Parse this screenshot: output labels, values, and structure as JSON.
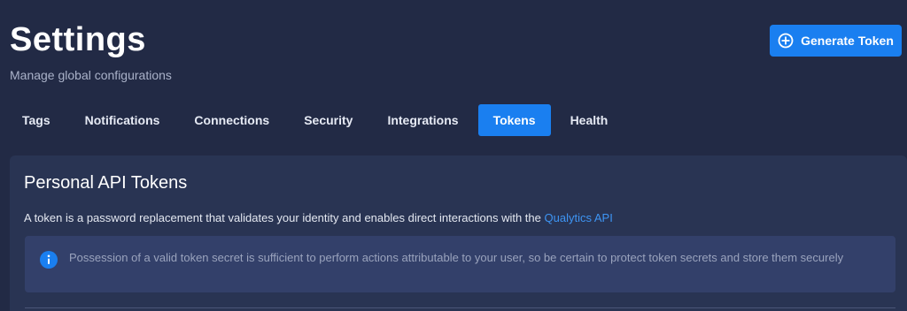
{
  "header": {
    "title": "Settings",
    "subtitle": "Manage global configurations",
    "generate_button_label": "Generate Token"
  },
  "tabs": [
    {
      "label": "Tags",
      "active": false
    },
    {
      "label": "Notifications",
      "active": false
    },
    {
      "label": "Connections",
      "active": false
    },
    {
      "label": "Security",
      "active": false
    },
    {
      "label": "Integrations",
      "active": false
    },
    {
      "label": "Tokens",
      "active": true
    },
    {
      "label": "Health",
      "active": false
    }
  ],
  "tokens_panel": {
    "title": "Personal API Tokens",
    "description": "A token is a password replacement that validates your identity and enables direct interactions with the ",
    "link_text": "Qualytics API",
    "info_message": "Possession of a valid token secret is sufficient to perform actions attributable to your user, so be certain to protect token secrets and store them securely"
  },
  "icons": {
    "generate_button": "plus-circle-icon",
    "info": "info-icon"
  },
  "colors": {
    "background": "#222a45",
    "panel": "#293453",
    "accent": "#1a7ff0",
    "link": "#3e95f4",
    "alert_background": "#33406a"
  }
}
